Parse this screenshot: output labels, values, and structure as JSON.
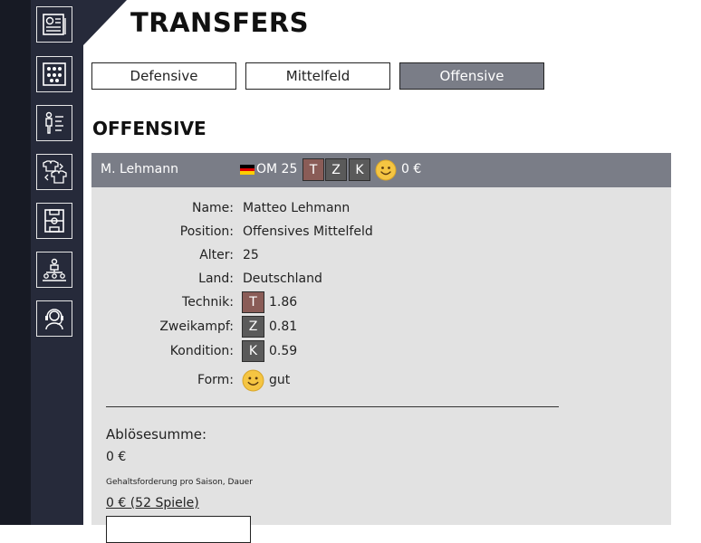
{
  "header": {
    "title": "TRANSFERS"
  },
  "sidebar": {
    "items": [
      {
        "icon": "newspaper-icon"
      },
      {
        "icon": "team-grid-icon"
      },
      {
        "icon": "tactics-board-icon"
      },
      {
        "icon": "jersey-swap-icon"
      },
      {
        "icon": "pitch-icon"
      },
      {
        "icon": "org-chart-icon"
      },
      {
        "icon": "support-agent-icon"
      }
    ]
  },
  "tabs": [
    {
      "label": "Defensive",
      "active": false
    },
    {
      "label": "Mittelfeld",
      "active": false
    },
    {
      "label": "Offensive",
      "active": true
    }
  ],
  "section": {
    "title": "OFFENSIVE"
  },
  "player_bar": {
    "name": "M. Lehmann",
    "position_age": "OM 25",
    "attrs": [
      "T",
      "Z",
      "K"
    ],
    "value": "0 €"
  },
  "details": {
    "rows": [
      {
        "label": "Name:",
        "value": "Matteo Lehmann"
      },
      {
        "label": "Position:",
        "value": "Offensives Mittelfeld"
      },
      {
        "label": "Alter:",
        "value": "25"
      },
      {
        "label": "Land:",
        "value": "Deutschland"
      }
    ],
    "stats": [
      {
        "label": "Technik:",
        "letter": "T",
        "value": "1.86",
        "color": "#8a5c57"
      },
      {
        "label": "Zweikampf:",
        "letter": "Z",
        "value": "0.81",
        "color": "#5a5a5a"
      },
      {
        "label": "Kondition:",
        "letter": "K",
        "value": "0.59",
        "color": "#5a5a5a"
      }
    ],
    "form_label": "Form:",
    "form_value": "gut"
  },
  "transfer": {
    "fee_label": "Ablösesumme:",
    "fee_value": "0 €",
    "salary_note": "Gehaltsforderung pro Saison, Dauer",
    "salary_value": "0 € (52 Spiele)"
  },
  "colors": {
    "sidebar_bg": "#262a3a",
    "header_bar": "#7a7d87",
    "panel_bg": "#e2e2e2",
    "technik_box": "#8a5c57",
    "stat_box": "#5a5a5a",
    "smiley": "#f5c542"
  }
}
